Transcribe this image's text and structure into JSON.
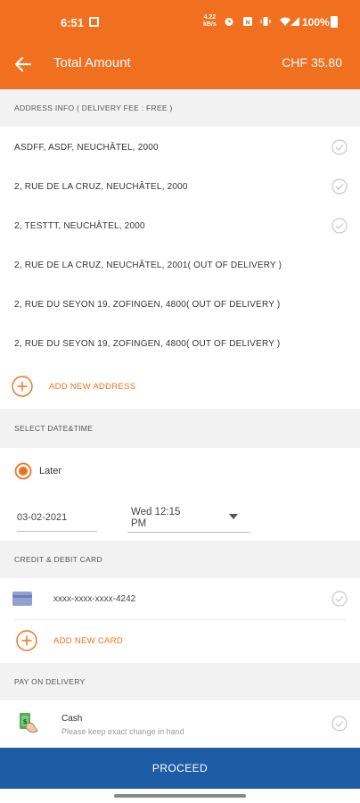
{
  "status_bar": {
    "time": "6:51",
    "net_speed_value": "4.22",
    "net_speed_unit": "kB/s",
    "battery": "100%"
  },
  "app_bar": {
    "title": "Total Amount",
    "amount": "CHF 35.80"
  },
  "address_section": {
    "header": "ADDRESS INFO ( DELIVERY FEE : FREE )",
    "addresses": [
      "ASDFF, ASDF, NEUCHÂTEL, 2000",
      "2, RUE DE LA CRUZ, NEUCHÂTEL, 2000",
      "2, TESTTT, NEUCHÂTEL, 2000",
      "2, RUE DE LA CRUZ, NEUCHÂTEL, 2001( OUT OF DELIVERY )",
      "2, RUE DU SEYON 19, ZOFINGEN, 4800( OUT OF DELIVERY )",
      "2, RUE DU SEYON 19, ZOFINGEN, 4800( OUT OF DELIVERY )"
    ],
    "add_label": "ADD NEW ADDRESS"
  },
  "datetime_section": {
    "header": "SELECT DATE&TIME",
    "option": "Later",
    "date": "03-02-2021",
    "time_line1": "Wed 12:15",
    "time_line2": "PM"
  },
  "card_section": {
    "header": "CREDIT & DEBIT CARD",
    "card_number": "xxxx-xxxx-xxxx-4242",
    "add_label": "ADD NEW CARD"
  },
  "pod_section": {
    "header": "PAY ON DELIVERY",
    "title": "Cash",
    "subtitle": "Please keep exact change in hand"
  },
  "proceed_label": "PROCEED",
  "colors": {
    "accent": "#f07020",
    "primary_button": "#1f5ca6"
  }
}
